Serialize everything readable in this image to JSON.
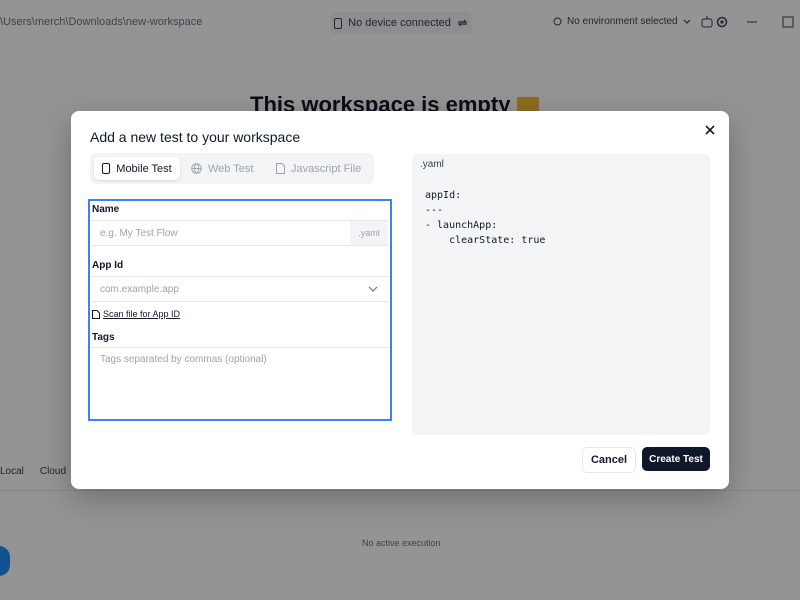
{
  "app": {
    "path": "\\Users\\merch\\Downloads\\new-workspace",
    "device_status": "No device connected",
    "environment": "No environment selected",
    "empty_title": "This workspace is empty",
    "bottom_tabs": [
      "Local",
      "Cloud"
    ],
    "no_execution": "No active execution"
  },
  "modal": {
    "title": "Add a new test to your workspace",
    "tabs": [
      {
        "label": "Mobile Test",
        "icon": "phone-icon",
        "active": true
      },
      {
        "label": "Web Test",
        "icon": "globe-icon",
        "active": false
      },
      {
        "label": "Javascript File",
        "icon": "file-icon",
        "active": false
      }
    ],
    "form": {
      "name_label": "Name",
      "name_placeholder": "e.g. My Test Flow",
      "name_suffix": ".yaml",
      "appid_label": "App Id",
      "appid_placeholder": "com.example.app",
      "scan_link": "Scan file for App ID",
      "tags_label": "Tags",
      "tags_placeholder": "Tags separated by commas (optional)"
    },
    "yaml": {
      "header": ".yaml",
      "code": "appId:\n---\n- launchApp:\n    clearState: true"
    },
    "buttons": {
      "cancel": "Cancel",
      "create": "Create Test"
    }
  },
  "colors": {
    "accent_blue": "#3b82f6",
    "primary_button": "#0f172a"
  }
}
